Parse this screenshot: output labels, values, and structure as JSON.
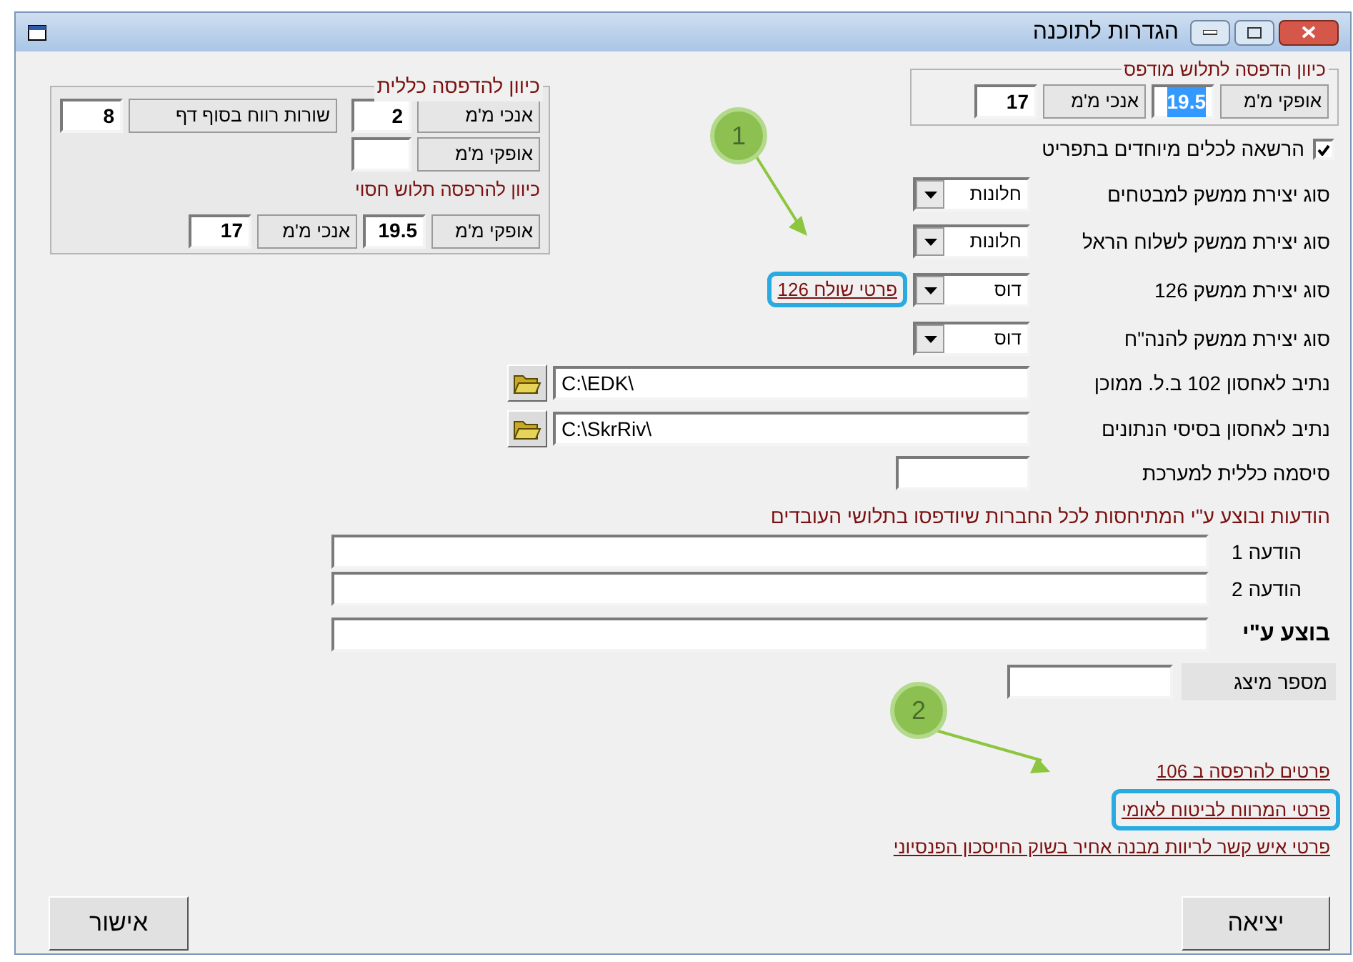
{
  "window": {
    "title": "הגדרות לתוכנה"
  },
  "printed_slip": {
    "legend": "כיוון הדפסה לתלוש מודפס",
    "horizontal": {
      "label": "אופקי מ'מ",
      "value": "19.5",
      "selected": true
    },
    "vertical": {
      "label": "אנכי מ'מ",
      "value": "17",
      "selected": false
    }
  },
  "general_print": {
    "legend": "כיוון להדפסה כללית",
    "vertical": {
      "label": "אנכי מ'מ",
      "value": "2"
    },
    "spacing": {
      "label": "שורות רווח בסוף דף",
      "value": "8"
    },
    "horizontal": {
      "label": "אופקי מ'מ"
    },
    "hidden_title": "כיוון להרפסה תלוש חסוי",
    "hidden_horizontal": {
      "label": "אופקי מ'מ",
      "value": "19.5"
    },
    "hidden_vertical": {
      "label": "אנכי מ'מ",
      "value": "17"
    }
  },
  "special_permissions": {
    "label": "הרשאה לכלים מיוחדים בתפריט",
    "checked": true
  },
  "interface_rows": [
    {
      "label": "סוג יצירת ממשק למבטחים",
      "value": "חלונות"
    },
    {
      "label": "סוג יצירת ממשק לשלוח הראל",
      "value": "חלונות"
    },
    {
      "label": "סוג יצירת ממשק 126",
      "value": "דוס",
      "link": {
        "text": "פרטי שולח 126",
        "highlighted": true
      }
    },
    {
      "label": "סוג יצירת ממשק להנה\"ח",
      "value": "דוס"
    }
  ],
  "paths": [
    {
      "label": "נתיב לאחסון 102 ב.ל. ממוכן",
      "value": "C:\\EDK\\"
    },
    {
      "label": "נתיב לאחסון בסיסי הנתונים",
      "value": "C:\\SkrRiv\\"
    }
  ],
  "password": {
    "label": "סיסמה כללית למערכת"
  },
  "messages_header": "הודעות ובוצע ע\"י המתיחסות לכל החברות שיודפסו בתלושי העובדים",
  "messages": [
    {
      "label": "הודעה 1"
    },
    {
      "label": "הודעה 2"
    }
  ],
  "done_by": {
    "label": "בוצע ע\"י"
  },
  "display_number": {
    "label": "מספר מיצג"
  },
  "links": [
    {
      "text": "פרטים להרפסה ב 106",
      "highlighted": false
    },
    {
      "text": "פרטי המרווח לביטוח לאומי",
      "highlighted": true
    },
    {
      "text": "פרטי איש קשר לריוות מבנה אחיר בשוק החיסכון הפנסיוני",
      "highlighted": false
    }
  ],
  "buttons": {
    "ok": "אישור",
    "exit": "יציאה"
  },
  "callouts": [
    {
      "number": "1"
    },
    {
      "number": "2"
    }
  ]
}
